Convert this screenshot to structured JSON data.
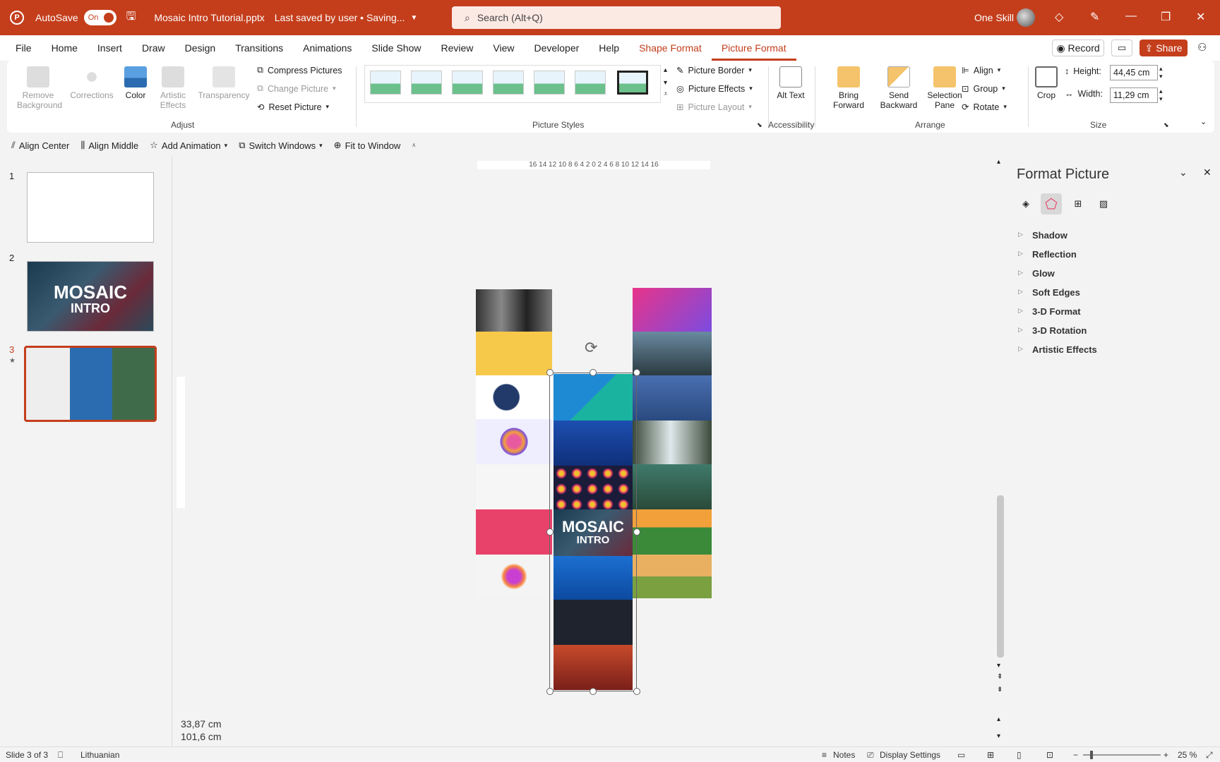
{
  "titlebar": {
    "autosave_label": "AutoSave",
    "autosave_state": "On",
    "filename": "Mosaic Intro Tutorial.pptx",
    "save_status": "Last saved by user • Saving...",
    "search_placeholder": "Search (Alt+Q)",
    "user_name": "One Skill"
  },
  "menu": {
    "items": [
      "File",
      "Home",
      "Insert",
      "Draw",
      "Design",
      "Transitions",
      "Animations",
      "Slide Show",
      "Review",
      "View",
      "Developer",
      "Help",
      "Shape Format",
      "Picture Format"
    ],
    "record_label": "Record",
    "share_label": "Share"
  },
  "ribbon": {
    "adjust": {
      "remove_background": "Remove Background",
      "corrections": "Corrections",
      "color": "Color",
      "artistic_effects": "Artistic Effects",
      "transparency": "Transparency",
      "compress": "Compress Pictures",
      "change": "Change Picture",
      "reset": "Reset Picture",
      "label": "Adjust"
    },
    "styles": {
      "border": "Picture Border",
      "effects": "Picture Effects",
      "layout": "Picture Layout",
      "label": "Picture Styles"
    },
    "accessibility": {
      "alt_text": "Alt Text",
      "label": "Accessibility"
    },
    "arrange": {
      "bring_forward": "Bring Forward",
      "send_backward": "Send Backward",
      "selection_pane": "Selection Pane",
      "align": "Align",
      "group": "Group",
      "rotate": "Rotate",
      "label": "Arrange"
    },
    "size": {
      "crop": "Crop",
      "height_label": "Height:",
      "height_value": "44,45 cm",
      "width_label": "Width:",
      "width_value": "11,29 cm",
      "label": "Size"
    }
  },
  "qat": {
    "align_center": "Align Center",
    "align_middle": "Align Middle",
    "add_animation": "Add Animation",
    "switch_windows": "Switch Windows",
    "fit_to_window": "Fit to Window"
  },
  "thumbnails": {
    "numbers": [
      "1",
      "2",
      "3"
    ],
    "slide2_line1": "MOSAIC",
    "slide2_line2": "INTRO"
  },
  "ruler": {
    "h_ticks": "16 14 12 10 8 6 4 2 0 2 4 6 8 10 12 14 16"
  },
  "canvas": {
    "mosaic_line1": "MOSAIC",
    "mosaic_line2": "INTRO",
    "dim_w": "33,87 cm",
    "dim_h": "101,6 cm"
  },
  "pane": {
    "title": "Format Picture",
    "sections": [
      "Shadow",
      "Reflection",
      "Glow",
      "Soft Edges",
      "3-D Format",
      "3-D Rotation",
      "Artistic Effects"
    ]
  },
  "status": {
    "slide": "Slide 3 of 3",
    "language": "Lithuanian",
    "notes": "Notes",
    "display": "Display Settings",
    "zoom": "25 %"
  }
}
